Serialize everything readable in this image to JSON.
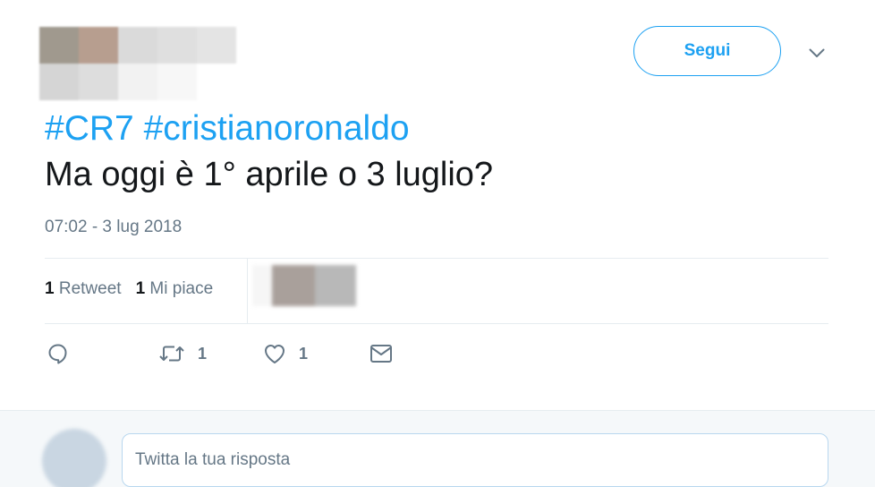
{
  "header": {
    "follow_label": "Segui"
  },
  "tweet": {
    "hashtags": [
      "#CR7",
      "#cristianoronaldo"
    ],
    "text": "Ma oggi è 1° aprile o 3 luglio?",
    "timestamp": "07:02 - 3 lug 2018"
  },
  "stats": {
    "retweets_count": "1",
    "retweets_label": "Retweet",
    "likes_count": "1",
    "likes_label": "Mi piace"
  },
  "actions": {
    "reply_icon": "reply-icon",
    "retweet_icon": "retweet-icon",
    "retweet_count": "1",
    "like_icon": "heart-icon",
    "like_count": "1",
    "message_icon": "envelope-icon"
  },
  "reply": {
    "placeholder": "Twitta la tua risposta"
  },
  "colors": {
    "accent": "#1da1f2",
    "muted": "#657786",
    "text": "#14171a",
    "divider": "#e6ecf0"
  }
}
